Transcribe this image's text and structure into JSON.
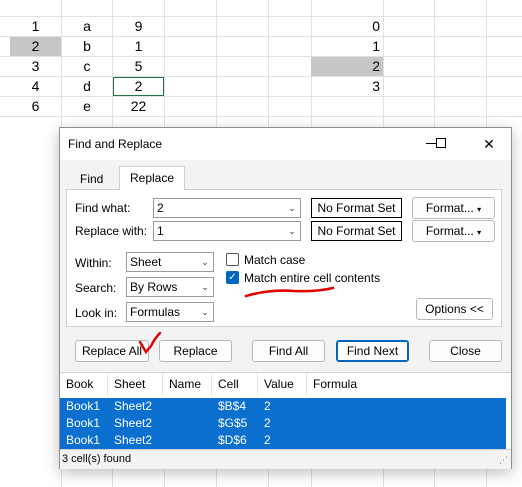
{
  "spreadsheet": {
    "col_b": [
      "1",
      "2",
      "3",
      "4",
      "6"
    ],
    "col_c": [
      "a",
      "b",
      "c",
      "d",
      "e"
    ],
    "col_d": [
      "9",
      "1",
      "5",
      "2",
      "22"
    ],
    "col_g": [
      "0",
      "1",
      "2",
      "3"
    ]
  },
  "dialog": {
    "title": "Find and Replace",
    "tabs": [
      "Find",
      "Replace"
    ],
    "find_what_label": "Find what:",
    "find_what_value": "2",
    "replace_with_label": "Replace with:",
    "replace_with_value": "1",
    "no_format_1": "No Format Set",
    "no_format_2": "No Format Set",
    "format_btn_1": "Format...",
    "format_btn_2": "Format...",
    "within_label": "Within:",
    "within_value": "Sheet",
    "search_label": "Search:",
    "search_value": "By Rows",
    "lookin_label": "Look in:",
    "lookin_value": "Formulas",
    "match_case_label": "Match case",
    "match_case_checked": false,
    "match_entire_label": "Match entire cell contents",
    "match_entire_checked": true,
    "options_button": "Options <<",
    "buttons": {
      "replace_all": "Replace All",
      "replace": "Replace",
      "find_all": "Find All",
      "find_next": "Find Next",
      "close": "Close"
    },
    "columns": [
      "Book",
      "Sheet",
      "Name",
      "Cell",
      "Value",
      "Formula"
    ],
    "results": [
      {
        "book": "Book1",
        "sheet": "Sheet2",
        "name": "",
        "cell": "$B$4",
        "value": "2",
        "formula": ""
      },
      {
        "book": "Book1",
        "sheet": "Sheet2",
        "name": "",
        "cell": "$G$5",
        "value": "2",
        "formula": ""
      },
      {
        "book": "Book1",
        "sheet": "Sheet2",
        "name": "",
        "cell": "$D$6",
        "value": "2",
        "formula": ""
      }
    ],
    "status": "3 cell(s) found"
  },
  "colors": {
    "accent": "#0067c0",
    "selected_row": "#0a6fcf",
    "annotation": "#e00000"
  }
}
